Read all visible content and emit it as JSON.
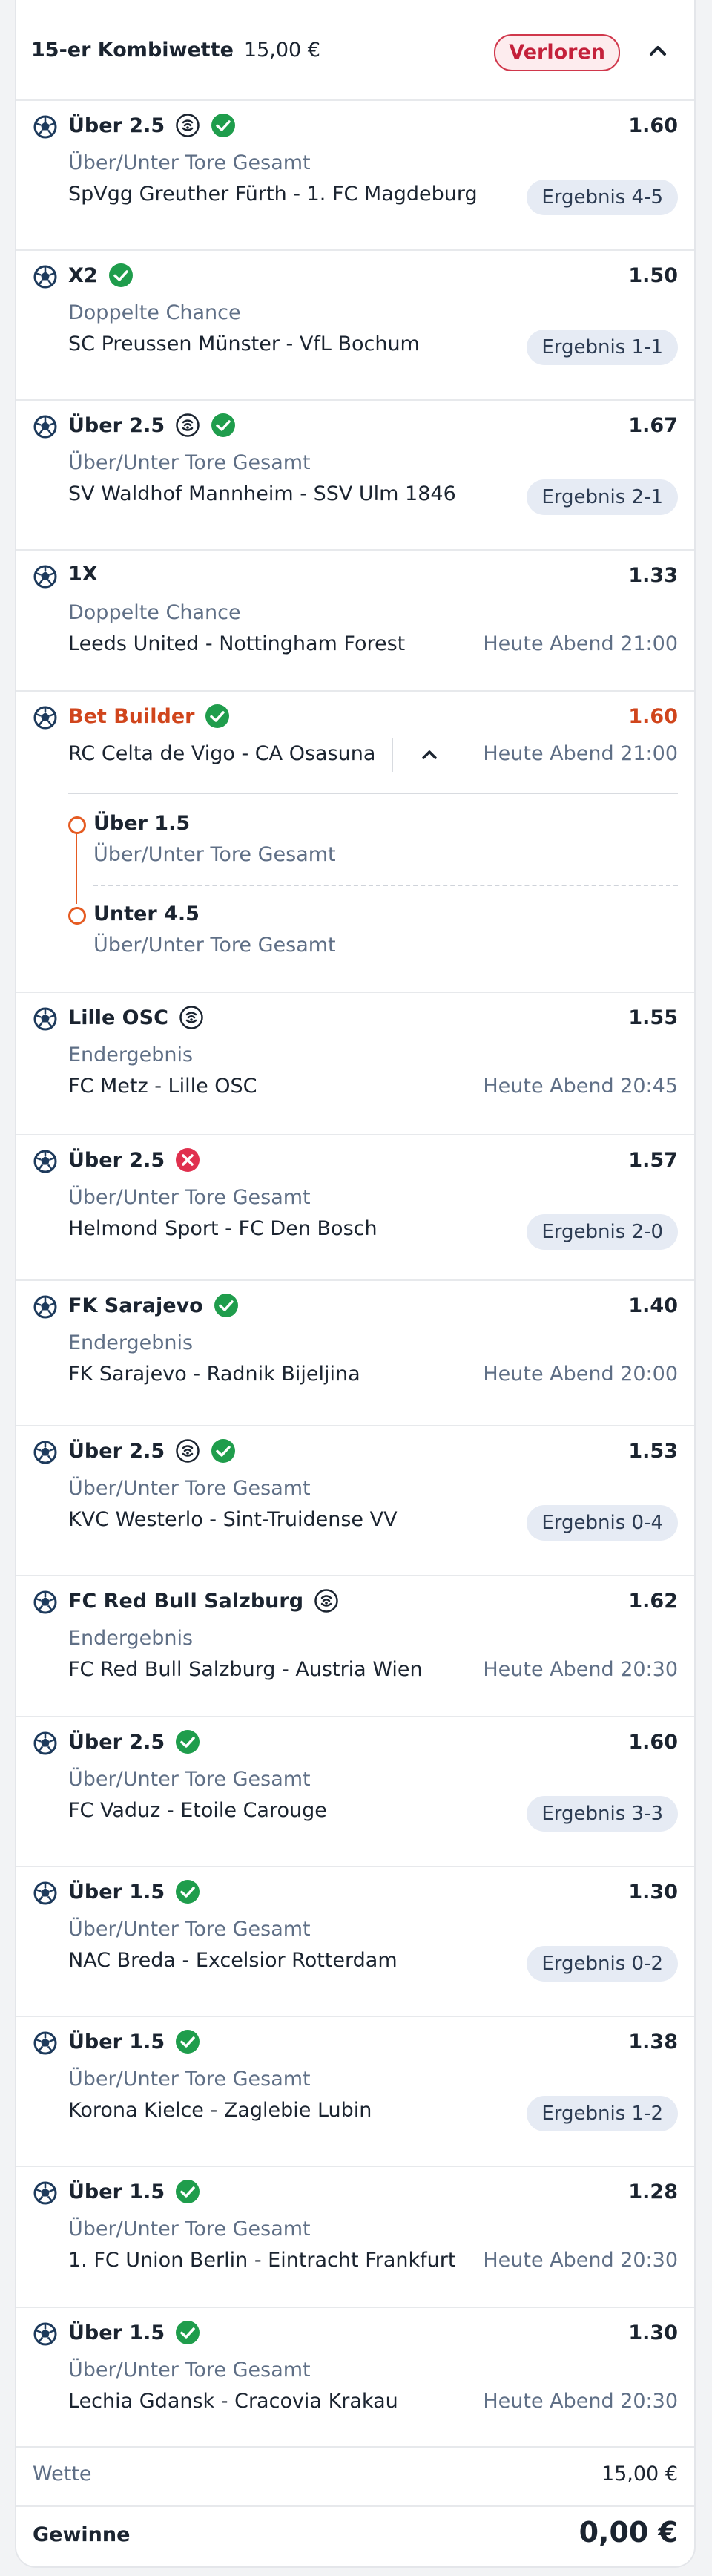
{
  "header": {
    "title": "15-er Kombiwette",
    "stake": "15,00 €",
    "status": "Verloren"
  },
  "legs": [
    {
      "pick": "Über 2.5",
      "odds": "1.60",
      "market": "Über/Unter Tore Gesamt",
      "match": "SpVgg Greuther Fürth - 1. FC Magdeburg",
      "result": "Ergebnis 4-5",
      "icons": [
        "live-stream-icon",
        "won-check-icon"
      ]
    },
    {
      "pick": "X2",
      "odds": "1.50",
      "market": "Doppelte Chance",
      "match": "SC Preussen Münster - VfL Bochum",
      "result": "Ergebnis 1-1",
      "icons": [
        "won-check-icon"
      ]
    },
    {
      "pick": "Über 2.5",
      "odds": "1.67",
      "market": "Über/Unter Tore Gesamt",
      "match": "SV Waldhof Mannheim - SSV Ulm 1846",
      "result": "Ergebnis 2-1",
      "icons": [
        "live-stream-icon",
        "won-check-icon"
      ]
    },
    {
      "pick": "1X",
      "odds": "1.33",
      "market": "Doppelte Chance",
      "match": "Leeds United - Nottingham Forest",
      "time": "Heute Abend 21:00",
      "icons": []
    },
    {
      "pick": "Lille OSC",
      "odds": "1.55",
      "market": "Endergebnis",
      "match": "FC Metz - Lille OSC",
      "time": "Heute Abend 20:45",
      "icons": [
        "live-stream-icon"
      ]
    },
    {
      "pick": "Über 2.5",
      "odds": "1.57",
      "market": "Über/Unter Tore Gesamt",
      "match": "Helmond Sport - FC Den Bosch",
      "result": "Ergebnis 2-0",
      "icons": [
        "lost-cross-icon"
      ]
    },
    {
      "pick": "FK Sarajevo",
      "odds": "1.40",
      "market": "Endergebnis",
      "match": "FK Sarajevo - Radnik Bijeljina",
      "time": "Heute Abend 20:00",
      "icons": [
        "won-check-icon"
      ]
    },
    {
      "pick": "Über 2.5",
      "odds": "1.53",
      "market": "Über/Unter Tore Gesamt",
      "match": "KVC Westerlo - Sint-Truidense VV",
      "result": "Ergebnis 0-4",
      "icons": [
        "live-stream-icon",
        "won-check-icon"
      ]
    },
    {
      "pick": "FC Red Bull Salzburg",
      "odds": "1.62",
      "market": "Endergebnis",
      "match": "FC Red Bull Salzburg - Austria Wien",
      "time": "Heute Abend 20:30",
      "icons": [
        "live-stream-icon"
      ]
    },
    {
      "pick": "Über 2.5",
      "odds": "1.60",
      "market": "Über/Unter Tore Gesamt",
      "match": "FC Vaduz - Etoile Carouge",
      "result": "Ergebnis 3-3",
      "icons": [
        "won-check-icon"
      ]
    },
    {
      "pick": "Über 1.5",
      "odds": "1.30",
      "market": "Über/Unter Tore Gesamt",
      "match": "NAC Breda - Excelsior Rotterdam",
      "result": "Ergebnis 0-2",
      "icons": [
        "won-check-icon"
      ]
    },
    {
      "pick": "Über 1.5",
      "odds": "1.38",
      "market": "Über/Unter Tore Gesamt",
      "match": "Korona Kielce - Zaglebie Lubin",
      "result": "Ergebnis 1-2",
      "icons": [
        "won-check-icon"
      ]
    },
    {
      "pick": "Über 1.5",
      "odds": "1.28",
      "market": "Über/Unter Tore Gesamt",
      "match": "1. FC Union Berlin - Eintracht Frankfurt",
      "time": "Heute Abend 20:30",
      "icons": [
        "won-check-icon"
      ]
    },
    {
      "pick": "Über 1.5",
      "odds": "1.30",
      "market": "Über/Unter Tore Gesamt",
      "match": "Lechia Gdansk - Cracovia Krakau",
      "time": "Heute Abend 20:30",
      "icons": [
        "won-check-icon"
      ]
    }
  ],
  "bet_builder": {
    "label": "Bet Builder",
    "odds": "1.60",
    "match": "RC Celta de Vigo - CA Osasuna",
    "time": "Heute Abend 21:00",
    "selections": [
      {
        "pick": "Über 1.5",
        "market": "Über/Unter Tore Gesamt"
      },
      {
        "pick": "Unter 4.5",
        "market": "Über/Unter Tore Gesamt"
      }
    ]
  },
  "footer": {
    "stake_label": "Wette",
    "stake_value": "15,00 €",
    "win_label": "Gewinne",
    "win_value": "0,00 €"
  },
  "colors": {
    "won": "#1f9d4c",
    "lost": "#d0374b",
    "bet_builder": "#d0451c",
    "muted": "#5f6f86"
  }
}
